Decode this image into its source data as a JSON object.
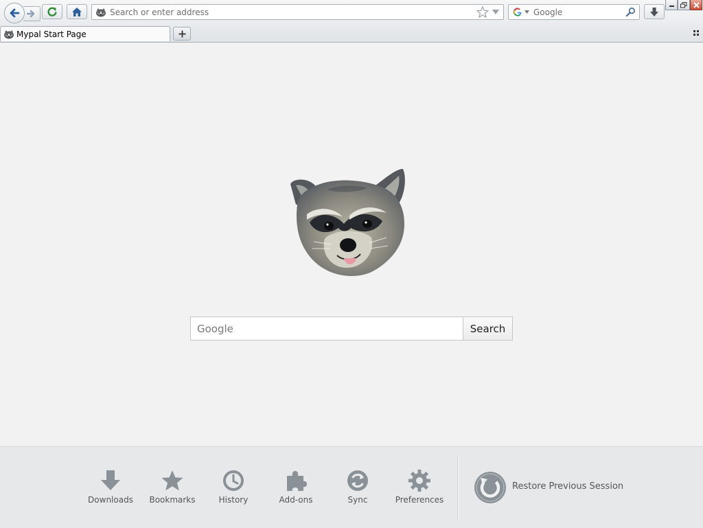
{
  "toolbar": {
    "address_placeholder": "Search or enter address",
    "search_engine_placeholder": "Google"
  },
  "tabs": [
    {
      "title": "Mypal Start Page",
      "active": true
    }
  ],
  "main": {
    "search_placeholder": "Google",
    "search_button": "Search"
  },
  "launcher": {
    "items": [
      {
        "label": "Downloads",
        "icon": "download-arrow-icon"
      },
      {
        "label": "Bookmarks",
        "icon": "star-icon"
      },
      {
        "label": "History",
        "icon": "clock-icon"
      },
      {
        "label": "Add-ons",
        "icon": "puzzle-icon"
      },
      {
        "label": "Sync",
        "icon": "sync-icon"
      },
      {
        "label": "Preferences",
        "icon": "gear-icon"
      }
    ],
    "restore_label": "Restore Previous Session"
  },
  "colors": {
    "page_bg": "#f2f2f2",
    "launcher_bg": "#e7e8ea",
    "launcher_icon": "#8a9197",
    "nav_blue": "#2c5d9c",
    "reload_green": "#2f8c35"
  }
}
